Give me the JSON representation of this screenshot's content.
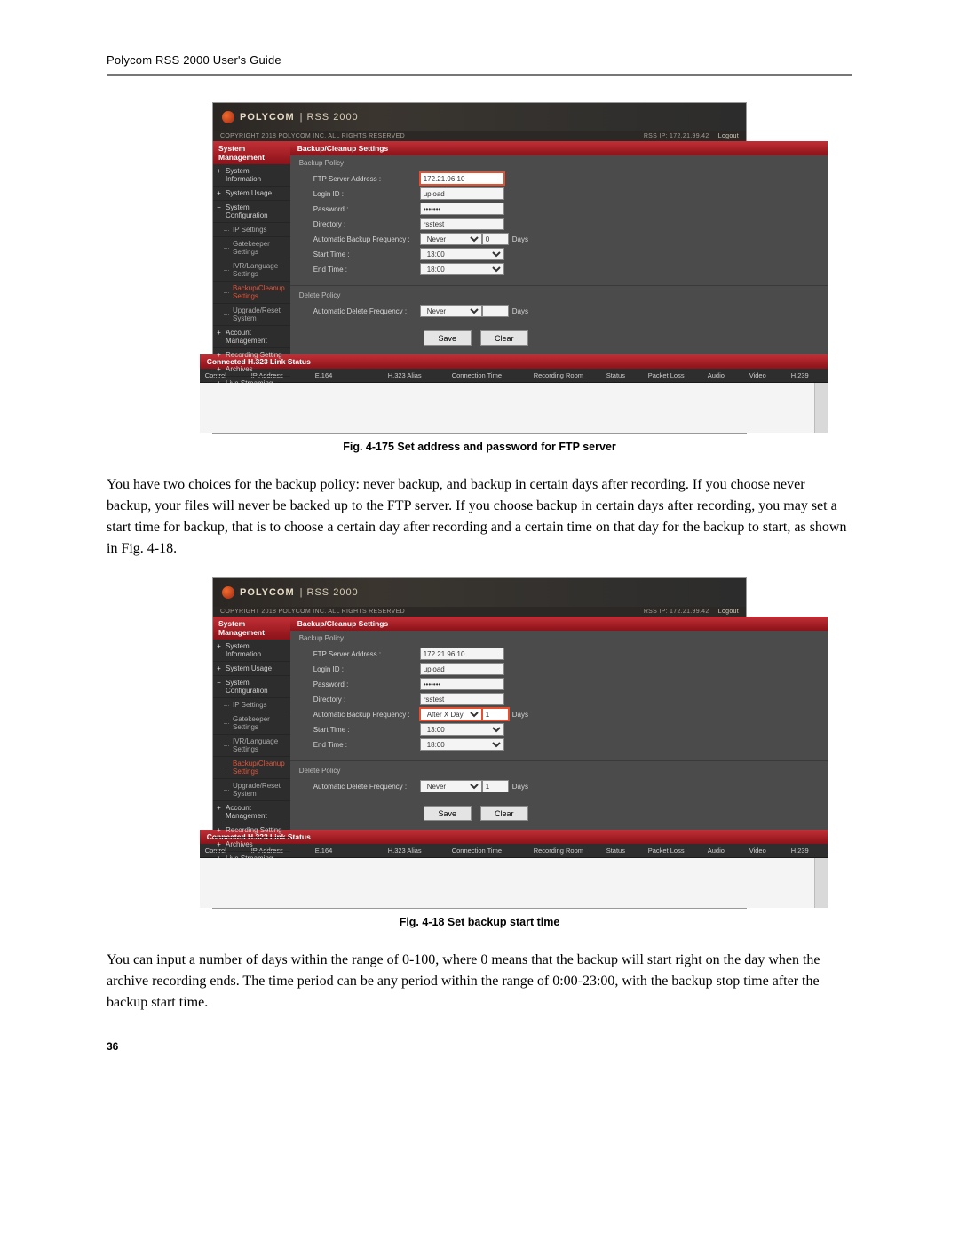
{
  "page": {
    "header": "Polycom RSS 2000 User's Guide",
    "number": "36"
  },
  "body_text": {
    "p1": "You have two choices for the backup policy: never backup, and backup in certain days after recording. If you choose never backup, your files will never be backed up to the FTP server. If you choose backup in certain days after recording, you may set a start time for backup, that is to choose a certain day after recording and a certain time on that day for the backup to start, as shown in Fig. 4-18.",
    "p2": "You can input a number of days within the range of 0-100, where 0 means that the backup will start right on the day when the archive recording ends. The time period can be any period within the range of 0:00-23:00, with the backup stop time after the backup start time."
  },
  "captions": {
    "c1": "Fig. 4-175 Set address and password for FTP server",
    "c2": "Fig. 4-18 Set backup start time"
  },
  "ui": {
    "brand": "POLYCOM",
    "model": "RSS 2000",
    "copyright": "COPYRIGHT 2018 POLYCOM INC. ALL RIGHTS RESERVED",
    "ip_label": "RSS IP: 172.21.99.42",
    "logout": "Logout",
    "sidebar_title": "System Management",
    "content_title": "Backup/Cleanup Settings",
    "nav": {
      "sys_info": "System Information",
      "sys_usage": "System Usage",
      "sys_conf": "System Configuration",
      "ip": "IP Settings",
      "gate": "Gatekeeper Settings",
      "ivr": "IVR/Language Settings",
      "backup": "Backup/Cleanup Settings",
      "upgrade": "Upgrade/Reset System",
      "acct": "Account Management",
      "rec": "Recording Setting",
      "arch": "Archives",
      "live": "Live Streaming"
    },
    "section": {
      "backup": "Backup Policy",
      "delete": "Delete Policy"
    },
    "labels": {
      "ftp": "FTP Server Address :",
      "login": "Login ID :",
      "pwd": "Password :",
      "dir": "Directory :",
      "abf": "Automatic Backup Frequency :",
      "start": "Start Time :",
      "end": "End Time :",
      "adf": "Automatic Delete Frequency :",
      "days": "Days"
    },
    "values": {
      "ftp": "172.21.96.10",
      "login": "upload",
      "pwd": "*******",
      "dir": "rsstest",
      "abf_never": "Never",
      "abf_after": "After X Days",
      "abf_days_a": "0",
      "abf_days_b": "1",
      "start": "13:00",
      "end": "18:00",
      "adf": "Never",
      "adf_days_a": "",
      "adf_days_b": "1"
    },
    "buttons": {
      "save": "Save",
      "clear": "Clear"
    },
    "linkstatus": {
      "title": "Connected H.323 Link Status",
      "control": "Control",
      "ip": "IP Address",
      "e164": "E.164",
      "alias": "H.323 Alias",
      "ctime": "Connection Time",
      "room": "Recording Room",
      "status": "Status",
      "loss": "Packet Loss",
      "audio": "Audio",
      "video": "Video",
      "h239": "H.239"
    }
  }
}
